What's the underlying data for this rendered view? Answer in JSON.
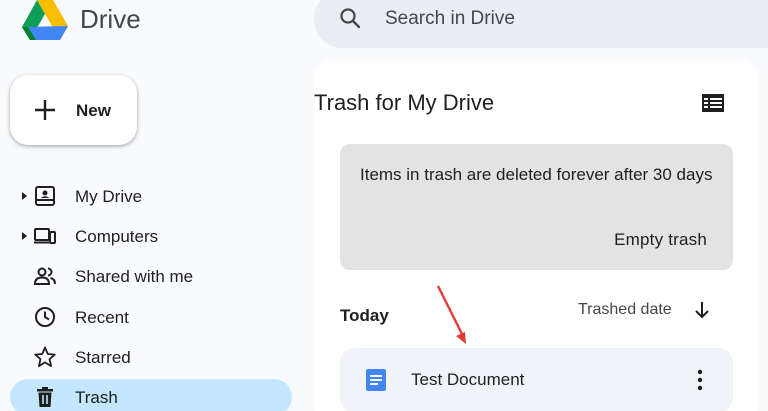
{
  "app": {
    "title": "Drive"
  },
  "search": {
    "placeholder": "Search in Drive"
  },
  "new_button": {
    "label": "New"
  },
  "sidebar": {
    "items": [
      {
        "label": "My Drive",
        "icon": "my-drive-icon"
      },
      {
        "label": "Computers",
        "icon": "computers-icon"
      },
      {
        "label": "Shared with me",
        "icon": "shared-icon"
      },
      {
        "label": "Recent",
        "icon": "clock-icon"
      },
      {
        "label": "Starred",
        "icon": "star-icon"
      },
      {
        "label": "Trash",
        "icon": "trash-icon",
        "active": true
      }
    ]
  },
  "main": {
    "title": "Trash for My Drive",
    "notice": {
      "message": "Items in trash are deleted forever after 30 days",
      "empty_label": "Empty trash"
    },
    "section": "Today",
    "sort_label": "Trashed date",
    "files": [
      {
        "name": "Test Document",
        "type": "document"
      }
    ]
  },
  "colors": {
    "active_nav": "#c2e7ff",
    "doc_icon": "#4285f4",
    "annotation_arrow": "#e53935",
    "search_bg": "#e9eef6"
  }
}
